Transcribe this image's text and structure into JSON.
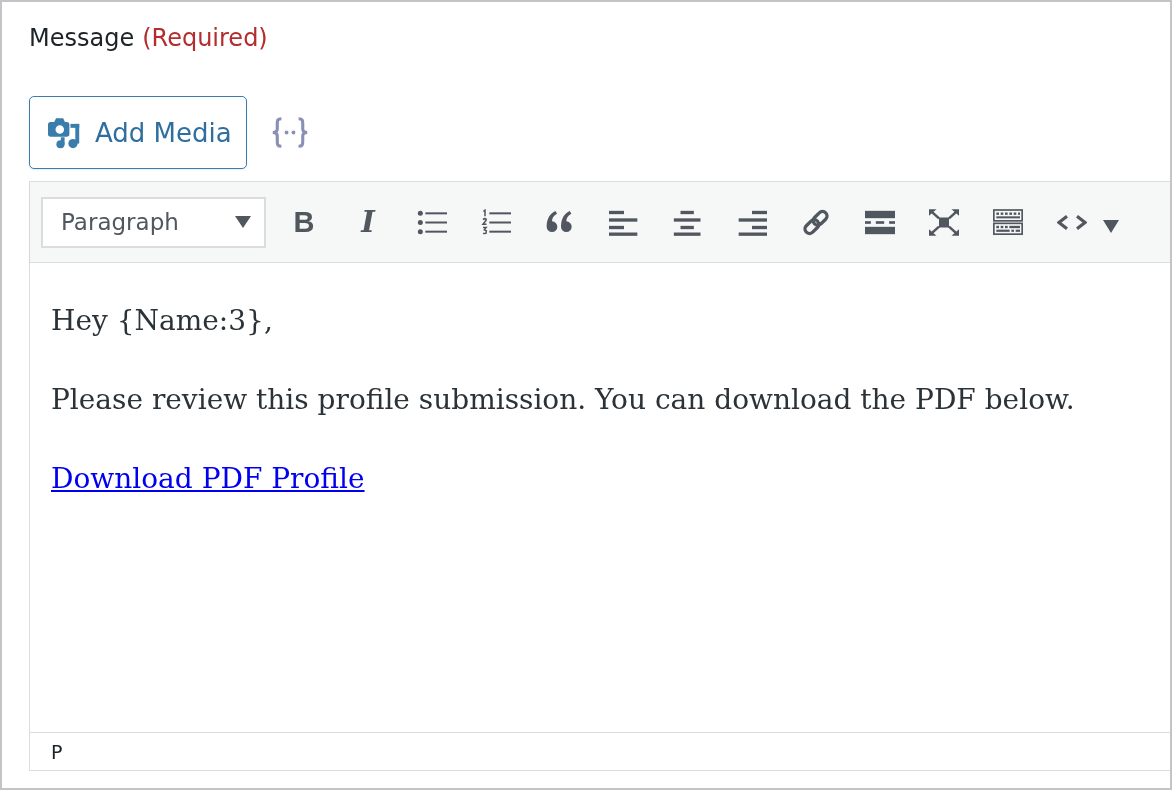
{
  "field": {
    "label": "Message",
    "required_note": "(Required)"
  },
  "media_button": {
    "label": "Add Media"
  },
  "editor": {
    "toolbar": {
      "format_select": {
        "value": "Paragraph"
      },
      "buttons": [
        {
          "kind": "bold",
          "glyph": "B"
        },
        {
          "kind": "italic",
          "glyph": "I"
        },
        {
          "kind": "bullet-list"
        },
        {
          "kind": "numbered-list"
        },
        {
          "kind": "quote"
        },
        {
          "kind": "align-left"
        },
        {
          "kind": "align-center"
        },
        {
          "kind": "align-right"
        },
        {
          "kind": "link"
        },
        {
          "kind": "read-more"
        },
        {
          "kind": "fullscreen"
        },
        {
          "kind": "toolbar-toggle"
        },
        {
          "kind": "code-menu"
        }
      ]
    },
    "content": [
      {
        "kind": "paragraph",
        "text": "Hey {Name:3},"
      },
      {
        "kind": "paragraph",
        "text": "Please review this profile submission. You can download the PDF below."
      },
      {
        "kind": "link",
        "text": "Download PDF Profile"
      }
    ],
    "status_bar": {
      "path": "P"
    }
  }
}
